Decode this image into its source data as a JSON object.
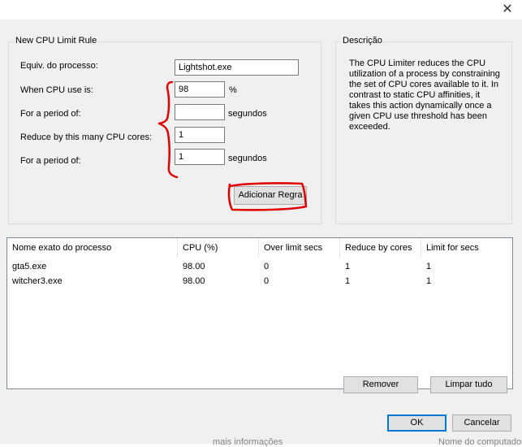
{
  "window": {
    "close_glyph": "✕"
  },
  "rule_group": {
    "title": "New CPU Limit Rule",
    "labels": {
      "process": "Equiv. do processo:",
      "cpu_use": "When CPU use is:",
      "period1": "For a period of:",
      "reduce_cores": "Reduce by this many CPU cores:",
      "period2": "For a period of:"
    },
    "values": {
      "process": "Lightshot.exe",
      "cpu_use": "98",
      "period1": "",
      "reduce_cores": "1",
      "period2": "1"
    },
    "units": {
      "cpu_use": "%",
      "period1": "segundos",
      "period2": "segundos"
    },
    "add_button": "Adicionar Regra"
  },
  "description_group": {
    "title": "Descrição",
    "text": "The CPU Limiter reduces the CPU utilization of a process by constraining the set of CPU cores available to it. In contrast to static CPU affinities, it takes this action dynamically once a given CPU use threshold has been exceeded."
  },
  "rules_table": {
    "columns": [
      "Nome exato do processo",
      "CPU (%)",
      "Over limit secs",
      "Reduce by cores",
      "Limit for secs"
    ],
    "rows": [
      [
        "gta5.exe",
        "98.00",
        "0",
        "1",
        "1"
      ],
      [
        "witcher3.exe",
        "98.00",
        "0",
        "1",
        "1"
      ]
    ]
  },
  "actions": {
    "remove": "Remover",
    "clear_all": "Limpar tudo",
    "ok": "OK",
    "cancel": "Cancelar"
  },
  "bottom_cut_text": {
    "left": "mais informações",
    "right": "Nome do computador"
  },
  "colors": {
    "annotation": "#e00000",
    "focus": "#0078d7"
  }
}
